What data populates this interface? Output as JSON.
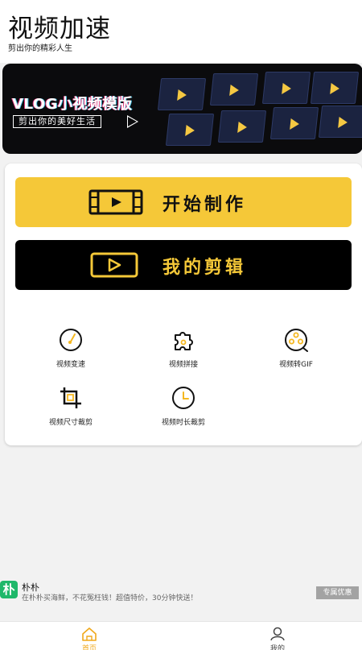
{
  "header": {
    "title": "视频加速",
    "subtitle": "剪出你的精彩人生"
  },
  "banner": {
    "title": "VLOG小视频模版",
    "tagline": "剪出你的美好生活"
  },
  "main": {
    "start_button": {
      "label": "开始制作",
      "icon": "film-play-icon"
    },
    "mine_button": {
      "label": "我的剪辑",
      "icon": "play-rect-icon"
    },
    "tools": [
      {
        "label": "视频变速",
        "icon": "speedometer-icon"
      },
      {
        "label": "视频拼接",
        "icon": "puzzle-icon"
      },
      {
        "label": "视频转GIF",
        "icon": "film-reel-icon"
      },
      {
        "label": "视频尺寸裁剪",
        "icon": "crop-icon"
      },
      {
        "label": "视频时长裁剪",
        "icon": "clock-icon"
      }
    ]
  },
  "ad": {
    "logo_text": "朴",
    "name": "朴朴",
    "description": "在朴朴买海鲜，不花冤枉钱！超值特价，30分钟快送！",
    "button_label": "专属优惠"
  },
  "tabbar": {
    "home_label": "首页",
    "mine_label": "我的"
  },
  "colors": {
    "accent": "#f5c838",
    "tab_active": "#f0a81a",
    "ad_logo": "#1fb86a"
  }
}
